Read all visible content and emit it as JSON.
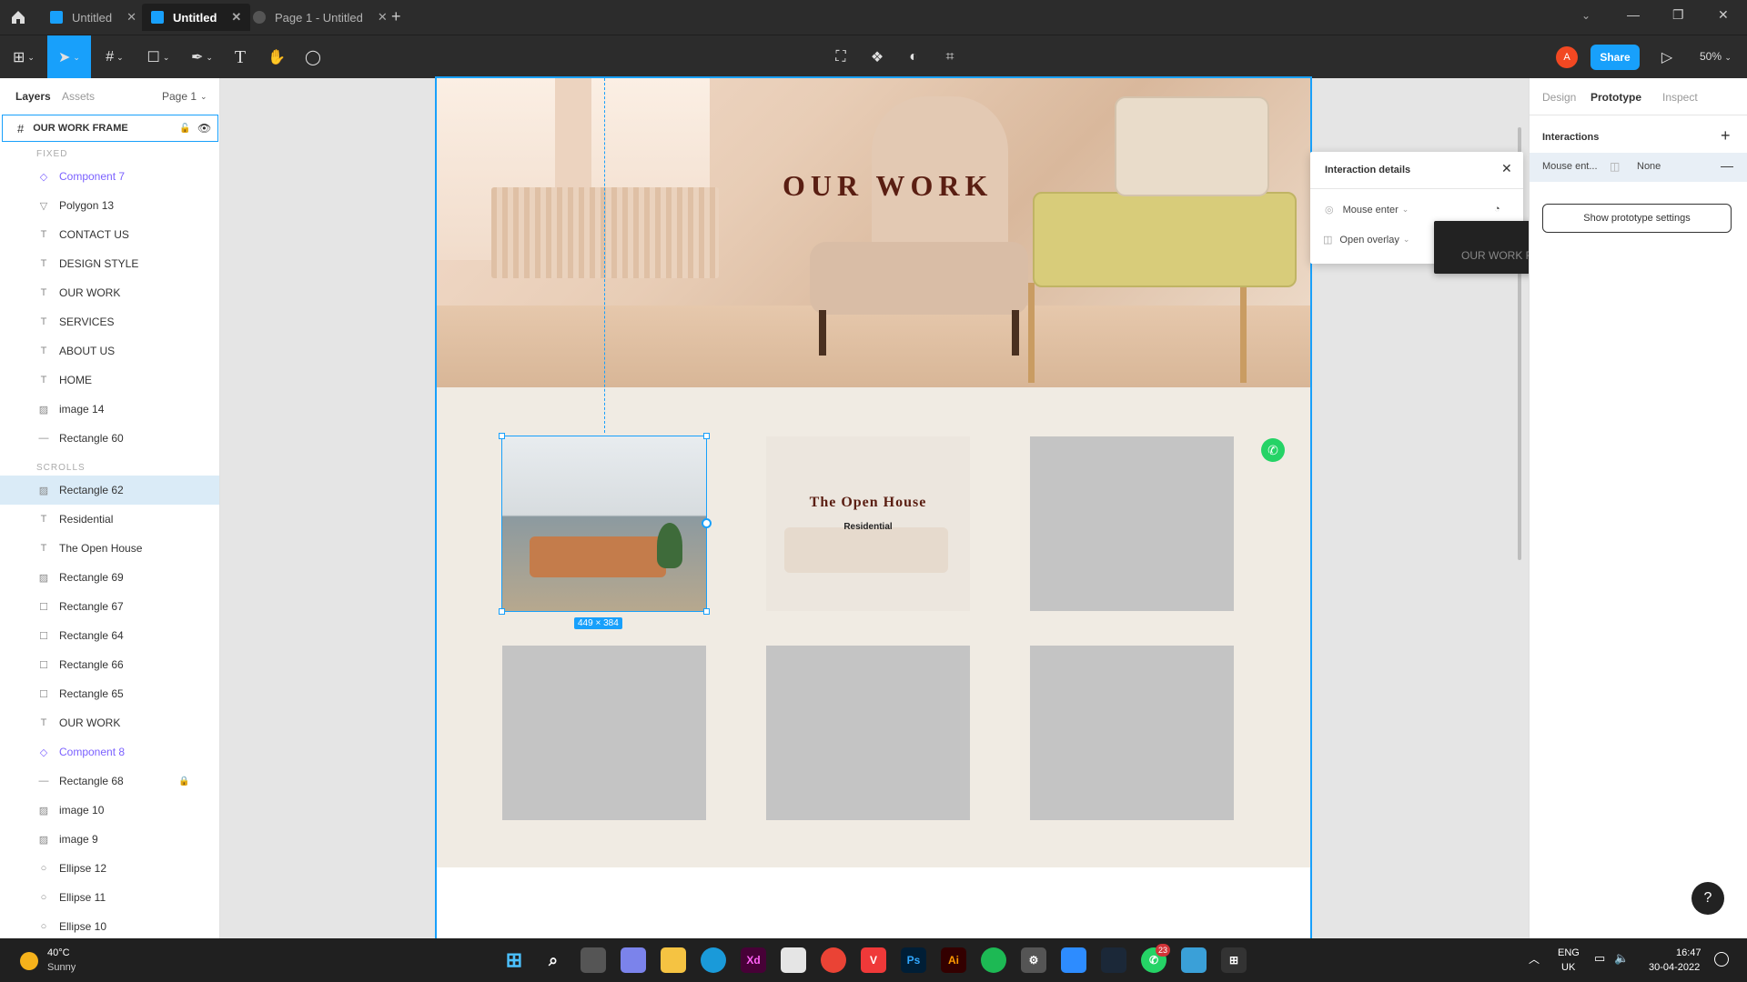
{
  "tabs": [
    {
      "label": "Untitled",
      "active": false
    },
    {
      "label": "Untitled",
      "active": true
    },
    {
      "label": "Page 1 - Untitled",
      "active": false
    }
  ],
  "toolbar": {
    "zoom": "50%",
    "share_label": "Share",
    "avatar_letter": "A"
  },
  "left_panel": {
    "tabs": [
      "Layers",
      "Assets"
    ],
    "page": "Page 1",
    "frame_name": "OUR WORK FRAME",
    "fixed_label": "FIXED",
    "scrolls_label": "SCROLLS",
    "fixed_layers": [
      {
        "name": "Component 7",
        "icon": "component-icon",
        "component": true
      },
      {
        "name": "Polygon 13",
        "icon": "polygon-icon"
      },
      {
        "name": "CONTACT US",
        "icon": "text-icon"
      },
      {
        "name": "DESIGN STYLE",
        "icon": "text-icon"
      },
      {
        "name": "OUR WORK",
        "icon": "text-icon"
      },
      {
        "name": "SERVICES",
        "icon": "text-icon"
      },
      {
        "name": "ABOUT US",
        "icon": "text-icon"
      },
      {
        "name": "HOME",
        "icon": "text-icon"
      },
      {
        "name": "image 14",
        "icon": "image-icon"
      },
      {
        "name": "Rectangle 60",
        "icon": "line-icon"
      }
    ],
    "scroll_layers": [
      {
        "name": "Rectangle 62",
        "icon": "image-icon",
        "selected": true
      },
      {
        "name": "Residential",
        "icon": "text-icon"
      },
      {
        "name": "The Open House",
        "icon": "text-icon"
      },
      {
        "name": "Rectangle 69",
        "icon": "image-icon"
      },
      {
        "name": "Rectangle 67",
        "icon": "rect-icon"
      },
      {
        "name": "Rectangle 64",
        "icon": "rect-icon"
      },
      {
        "name": "Rectangle 66",
        "icon": "rect-icon"
      },
      {
        "name": "Rectangle 65",
        "icon": "rect-icon"
      },
      {
        "name": "OUR WORK",
        "icon": "text-icon"
      },
      {
        "name": "Component 8",
        "icon": "component-icon",
        "component": true
      },
      {
        "name": "Rectangle 68",
        "icon": "line-icon",
        "locked": true
      },
      {
        "name": "image 10",
        "icon": "image-icon"
      },
      {
        "name": "image 9",
        "icon": "image-icon"
      },
      {
        "name": "Ellipse 12",
        "icon": "ellipse-icon"
      },
      {
        "name": "Ellipse 11",
        "icon": "ellipse-icon"
      },
      {
        "name": "Ellipse 10",
        "icon": "ellipse-icon"
      }
    ]
  },
  "canvas": {
    "hero_title": "OUR WORK",
    "card_title": "The Open House",
    "card_subtitle": "Residential",
    "size_badge": "449 × 384"
  },
  "interaction_popup": {
    "title": "Interaction details",
    "trigger": "Mouse enter",
    "action": "Open overlay",
    "dropdown_item": "OUR WORK FRAME"
  },
  "right_panel": {
    "tabs": [
      "Design",
      "Prototype",
      "Inspect"
    ],
    "interactions_label": "Interactions",
    "interaction_trigger": "Mouse ent...",
    "interaction_target": "None",
    "show_settings": "Show prototype settings"
  },
  "taskbar": {
    "temperature": "40°C",
    "weather": "Sunny",
    "lang1": "ENG",
    "lang2": "UK",
    "time": "16:47",
    "date": "30-04-2022",
    "notif_count": "23"
  },
  "colors": {
    "accent": "#18a0fb",
    "hero_text": "#5a1e12",
    "canvas_bg": "#f0ebe3",
    "placeholder": "#c4c4c4"
  }
}
